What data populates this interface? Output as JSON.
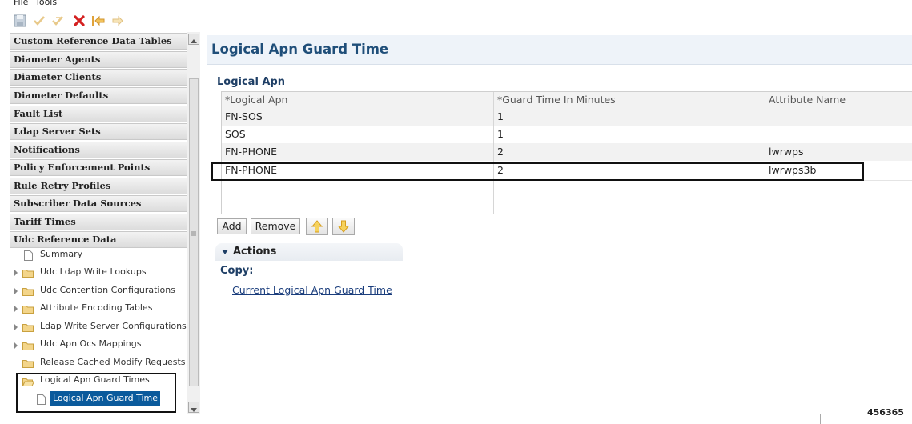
{
  "menu": {
    "file": "File",
    "tools": "Tools"
  },
  "sidebar": {
    "sections": [
      "Custom Reference Data Tables",
      "Diameter Agents",
      "Diameter Clients",
      "Diameter Defaults",
      "Fault List",
      "Ldap Server Sets",
      "Notifications",
      "Policy Enforcement Points",
      "Rule Retry Profiles",
      "Subscriber Data Sources",
      "Tariff Times",
      "Udc Reference Data"
    ],
    "tree": [
      "Summary",
      "Udc Ldap Write Lookups",
      "Udc Contention Configurations",
      "Attribute Encoding Tables",
      "Ldap Write Server Configurations",
      "Udc Apn Ocs Mappings",
      "Release Cached Modify Requests",
      "Logical Apn Guard Times",
      "Logical Apn Guard Time"
    ]
  },
  "main": {
    "title": "Logical Apn Guard Time",
    "section_title": "Logical Apn",
    "columns": [
      "*Logical Apn",
      "*Guard Time In Minutes",
      "Attribute Name"
    ],
    "rows": [
      [
        "FN-SOS",
        "1",
        ""
      ],
      [
        "SOS",
        "1",
        ""
      ],
      [
        "FN-PHONE",
        "2",
        "lwrwps"
      ],
      [
        "FN-PHONE",
        "2",
        "lwrwps3b"
      ]
    ],
    "buttons": {
      "add": "Add",
      "remove": "Remove"
    },
    "actions": {
      "label": "Actions",
      "copy_label": "Copy:",
      "copy_link": "Current Logical Apn Guard Time"
    }
  },
  "figure_id": "456365",
  "colors": {
    "title": "#1f4e79",
    "selected": "#0a5a9c",
    "row_alt": "#f2f2f2"
  }
}
